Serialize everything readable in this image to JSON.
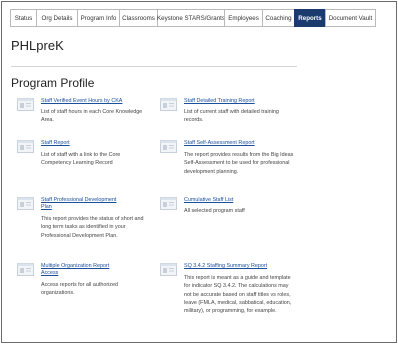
{
  "tabs": [
    {
      "label": "Status",
      "active": false
    },
    {
      "label": "Org Details",
      "active": false
    },
    {
      "label": "Program Info",
      "active": false
    },
    {
      "label": "Classrooms",
      "active": false
    },
    {
      "label": "Keystone STARS/Grants",
      "active": false
    },
    {
      "label": "Employees",
      "active": false
    },
    {
      "label": "Coaching",
      "active": false
    },
    {
      "label": "Reports",
      "active": true
    },
    {
      "label": "Document Vault",
      "active": false
    }
  ],
  "header": {
    "app_title": "PHLpreK",
    "section_title": "Program Profile"
  },
  "reports": [
    {
      "link": "Staff Verified Event Hours by CKA",
      "desc": "List of staff hours in each Core Knowledge Area."
    },
    {
      "link": "Staff Detailed Training Report",
      "desc": "List of current staff with detailed training records."
    },
    {
      "link": "Staff Report",
      "desc": "List of staff with a link to the Core Competency Learning Record"
    },
    {
      "link": "Staff Self-Assessment Report",
      "desc": "The report provides results from the Big Ideas Self-Assessment to be used for professional development planning."
    },
    {
      "link": "Staff Professional Development Plan",
      "desc": "This report provides the status of short and long term tasks as identified in your Professional Development Plan."
    },
    {
      "link": "Cumulative Staff List",
      "desc": "All selected program staff"
    },
    {
      "link": "Multiple Organization Report Access",
      "desc": "Access reports for all authorized organizations."
    },
    {
      "link": "SQ 3.4.2 Staffing Summary Report",
      "desc": "This report is meant as a guide and template for indicator SQ 3.4.2. The calculations may not be accurate based on staff titles vs roles, leave (FMLA, medical, sabbatical, education, military), or programming, for example."
    }
  ],
  "colors": {
    "active_tab": "#1b3b6f",
    "link": "#1a4f9c"
  },
  "icons": {
    "report": "report-icon"
  }
}
